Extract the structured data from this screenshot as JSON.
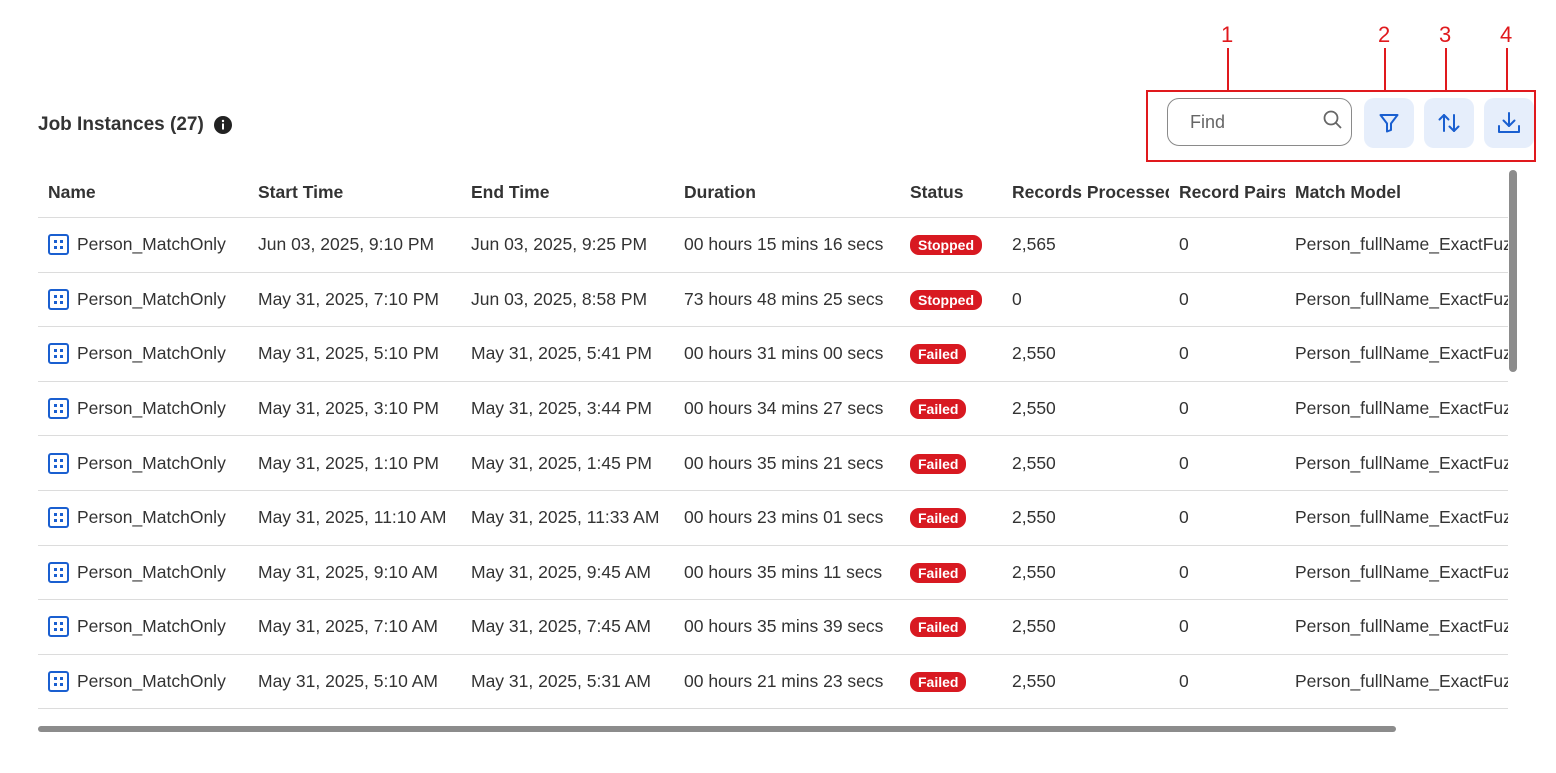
{
  "annotations": [
    "1",
    "2",
    "3",
    "4"
  ],
  "header": {
    "title": "Job Instances (27)"
  },
  "toolbar": {
    "search_placeholder": "Find"
  },
  "table": {
    "columns": [
      "Name",
      "Start Time",
      "End Time",
      "Duration",
      "Status",
      "Records Processed",
      "Record Pairs",
      "Match Model"
    ],
    "rows": [
      {
        "name": "Person_MatchOnly",
        "start": "Jun 03, 2025, 9:10 PM",
        "end": "Jun 03, 2025, 9:25 PM",
        "duration": "00 hours 15 mins 16 secs",
        "status": "Stopped",
        "records": "2,565",
        "pairs": "0",
        "model": "Person_fullName_ExactFuzzy"
      },
      {
        "name": "Person_MatchOnly",
        "start": "May 31, 2025, 7:10 PM",
        "end": "Jun 03, 2025, 8:58 PM",
        "duration": "73 hours 48 mins 25 secs",
        "status": "Stopped",
        "records": "0",
        "pairs": "0",
        "model": "Person_fullName_ExactFuzzy"
      },
      {
        "name": "Person_MatchOnly",
        "start": "May 31, 2025, 5:10 PM",
        "end": "May 31, 2025, 5:41 PM",
        "duration": "00 hours 31 mins 00 secs",
        "status": "Failed",
        "records": "2,550",
        "pairs": "0",
        "model": "Person_fullName_ExactFuzzy"
      },
      {
        "name": "Person_MatchOnly",
        "start": "May 31, 2025, 3:10 PM",
        "end": "May 31, 2025, 3:44 PM",
        "duration": "00 hours 34 mins 27 secs",
        "status": "Failed",
        "records": "2,550",
        "pairs": "0",
        "model": "Person_fullName_ExactFuzzy"
      },
      {
        "name": "Person_MatchOnly",
        "start": "May 31, 2025, 1:10 PM",
        "end": "May 31, 2025, 1:45 PM",
        "duration": "00 hours 35 mins 21 secs",
        "status": "Failed",
        "records": "2,550",
        "pairs": "0",
        "model": "Person_fullName_ExactFuzzy"
      },
      {
        "name": "Person_MatchOnly",
        "start": "May 31, 2025, 11:10 AM",
        "end": "May 31, 2025, 11:33 AM",
        "duration": "00 hours 23 mins 01 secs",
        "status": "Failed",
        "records": "2,550",
        "pairs": "0",
        "model": "Person_fullName_ExactFuzzy"
      },
      {
        "name": "Person_MatchOnly",
        "start": "May 31, 2025, 9:10 AM",
        "end": "May 31, 2025, 9:45 AM",
        "duration": "00 hours 35 mins 11 secs",
        "status": "Failed",
        "records": "2,550",
        "pairs": "0",
        "model": "Person_fullName_ExactFuzzy"
      },
      {
        "name": "Person_MatchOnly",
        "start": "May 31, 2025, 7:10 AM",
        "end": "May 31, 2025, 7:45 AM",
        "duration": "00 hours 35 mins 39 secs",
        "status": "Failed",
        "records": "2,550",
        "pairs": "0",
        "model": "Person_fullName_ExactFuzzy"
      },
      {
        "name": "Person_MatchOnly",
        "start": "May 31, 2025, 5:10 AM",
        "end": "May 31, 2025, 5:31 AM",
        "duration": "00 hours 21 mins 23 secs",
        "status": "Failed",
        "records": "2,550",
        "pairs": "0",
        "model": "Person_fullName_ExactFuzzy"
      },
      {
        "name": "",
        "start": "",
        "end": "",
        "duration": "",
        "status": "",
        "records": "",
        "pairs": "",
        "model": ""
      }
    ]
  },
  "icons": {
    "info": "info-icon",
    "search": "search-icon",
    "filter": "filter-icon",
    "sort": "sort-icon",
    "download": "download-icon",
    "job": "job-grid-icon"
  },
  "colors": {
    "accent": "#1a5fd0",
    "accent_bg": "#e6eefb",
    "status_failed": "#d81921",
    "status_stopped": "#d81921",
    "annotation": "#e0191d"
  }
}
